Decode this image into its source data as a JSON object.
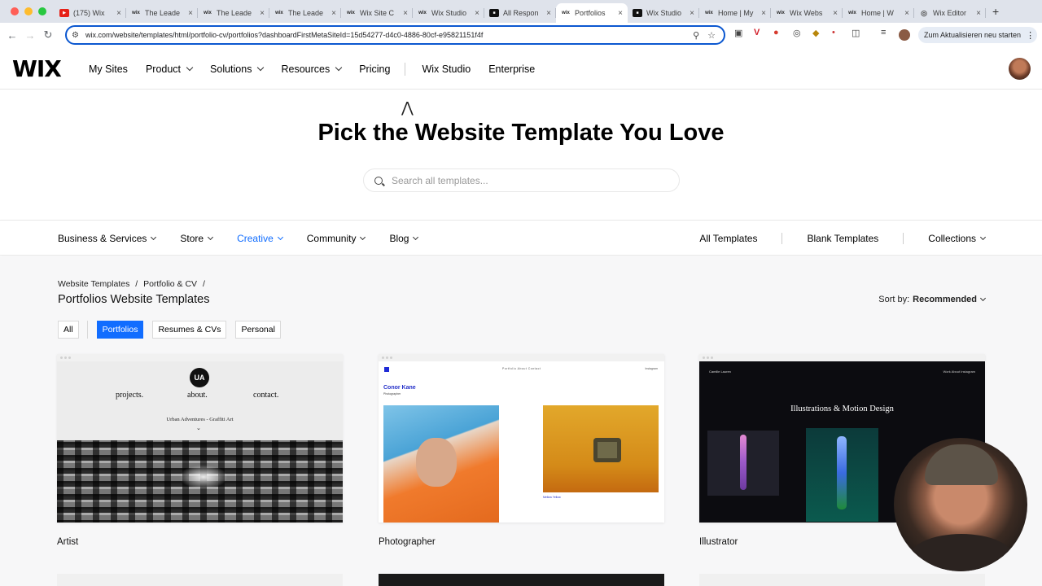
{
  "browser": {
    "tabs": [
      {
        "label": "(175) Wix",
        "fav": "yt"
      },
      {
        "label": "The Leade",
        "fav": "wix"
      },
      {
        "label": "The Leade",
        "fav": "wix"
      },
      {
        "label": "The Leade",
        "fav": "wix"
      },
      {
        "label": "Wix Site C",
        "fav": "wix"
      },
      {
        "label": "Wix Studio",
        "fav": "wix"
      },
      {
        "label": "All Respon",
        "fav": "ws"
      },
      {
        "label": "Portfolios",
        "fav": "wix",
        "active": true
      },
      {
        "label": "Wix Studio",
        "fav": "ws"
      },
      {
        "label": "Home | My",
        "fav": "wix"
      },
      {
        "label": "Wix Webs",
        "fav": "wix"
      },
      {
        "label": "Home | W",
        "fav": "wix"
      },
      {
        "label": "Wix Editor",
        "fav": "ed"
      }
    ],
    "url": "wix.com/website/templates/html/portfolio-cv/portfolios?dashboardFirstMetaSiteId=15d54277-d4c0-4886-80cf-e95821151f4f",
    "update_button": "Zum Aktualisieren neu starten"
  },
  "header": {
    "logo": "WIX",
    "nav": [
      {
        "label": "My Sites",
        "dropdown": false
      },
      {
        "label": "Product",
        "dropdown": true
      },
      {
        "label": "Solutions",
        "dropdown": true
      },
      {
        "label": "Resources",
        "dropdown": true
      },
      {
        "label": "Pricing",
        "dropdown": false
      }
    ],
    "nav_right": [
      "Wix Studio",
      "Enterprise"
    ]
  },
  "hero": {
    "title": "Pick the Website Template You Love",
    "search_placeholder": "Search all templates..."
  },
  "categories": {
    "left": [
      {
        "label": "Business & Services",
        "active": false
      },
      {
        "label": "Store",
        "active": false
      },
      {
        "label": "Creative",
        "active": true
      },
      {
        "label": "Community",
        "active": false
      },
      {
        "label": "Blog",
        "active": false
      }
    ],
    "right": {
      "all": "All Templates",
      "blank": "Blank Templates",
      "collections": "Collections"
    }
  },
  "listing": {
    "breadcrumbs": [
      "Website Templates",
      "/",
      "Portfolio & CV",
      "/"
    ],
    "title": "Portfolios Website Templates",
    "sort_label": "Sort by:",
    "sort_value": "Recommended",
    "filters": [
      {
        "label": "All",
        "active": false
      },
      {
        "label": "Portfolios",
        "active": true
      },
      {
        "label": "Resumes & CVs",
        "active": false
      },
      {
        "label": "Personal",
        "active": false
      }
    ],
    "templates": [
      {
        "name": "Artist"
      },
      {
        "name": "Photographer"
      },
      {
        "name": "Illustrator"
      }
    ]
  },
  "previews": {
    "artist": {
      "logo": "UA",
      "nav": [
        "projects.",
        "about.",
        "contact."
      ],
      "subtitle": "Urban Adventures - Graffiti Art"
    },
    "photographer": {
      "name": "Conor Kane",
      "role": "Photographer",
      "menu": "Portfolio   About   Contact",
      "social": "Instagram",
      "caption": "Mellow Yellow"
    },
    "illustrator": {
      "logo": "Camille Lauren",
      "menu": "Work      About      Instagram",
      "title": "Illustrations & Motion Design"
    }
  },
  "colors": {
    "accent": "#116dff",
    "url_focus": "#0b57d0"
  }
}
